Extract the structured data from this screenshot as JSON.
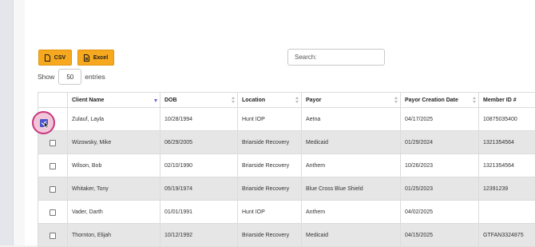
{
  "buttons": {
    "csv_label": "CSV",
    "excel_label": "Excel"
  },
  "search": {
    "placeholder": "Search:"
  },
  "length": {
    "show_label": "Show",
    "value": "50",
    "entries_label": "entries"
  },
  "table": {
    "headers": [
      "Client Name",
      "DOB",
      "Location",
      "Payor",
      "Payor Creation Date",
      "Member ID #"
    ],
    "sorted_column": "Client Name",
    "rows": [
      {
        "client": "Zulauf, Layla",
        "dob": "10/28/1994",
        "location": "Hunt IOP",
        "payor": "Aetna",
        "payor_date": "04/17/2025",
        "member_id": "10875035400"
      },
      {
        "client": "Wizowsky, Mike",
        "dob": "06/29/2005",
        "location": "Briarside Recovery",
        "payor": "Medicaid",
        "payor_date": "01/29/2024",
        "member_id": "1321354564"
      },
      {
        "client": "Wilson, Bob",
        "dob": "02/10/1990",
        "location": "Briarside Recovery",
        "payor": "Anthem",
        "payor_date": "10/26/2023",
        "member_id": "1321354564"
      },
      {
        "client": "Whitaker, Tony",
        "dob": "05/19/1974",
        "location": "Briarside Recovery",
        "payor": "Blue Cross Blue Shield",
        "payor_date": "01/25/2023",
        "member_id": "12391239"
      },
      {
        "client": "Vader, Darth",
        "dob": "01/01/1991",
        "location": "Hunt IOP",
        "payor": "Anthem",
        "payor_date": "04/02/2025",
        "member_id": ""
      },
      {
        "client": "Thornton, Elijah",
        "dob": "10/12/1992",
        "location": "Briarside Recovery",
        "payor": "Medicaid",
        "payor_date": "04/15/2025",
        "member_id": "GTFAN3324875"
      }
    ]
  },
  "colors": {
    "button_bg": "#f6a81e",
    "highlight_ring": "#c8387f",
    "checkbox_checked": "#4d54c9"
  }
}
